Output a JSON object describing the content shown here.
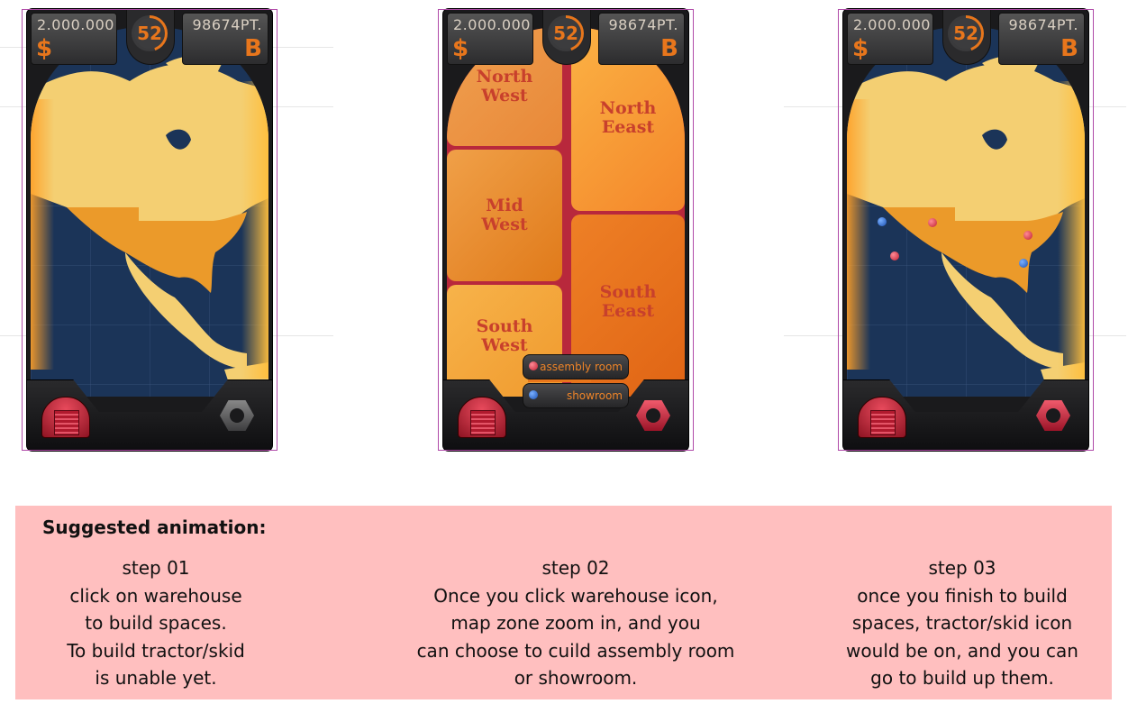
{
  "hud": {
    "money": "2.000.000",
    "money_symbol": "$",
    "level": "52",
    "points": "98674PT.",
    "points_symbol": "B"
  },
  "zones": {
    "north_west": [
      "North",
      "West"
    ],
    "mid_west": [
      "Mid",
      "West"
    ],
    "south_west": [
      "South",
      "West"
    ],
    "north_east": [
      "North",
      "Eeast"
    ],
    "south_east": [
      "South",
      "Eeast"
    ]
  },
  "room_menu": {
    "assembly": "assembly room",
    "showroom": "showroom"
  },
  "icons": {
    "warehouse": "warehouse-icon",
    "tractor": "tractor-skid-icon"
  },
  "colors": {
    "accent": "#e8761c",
    "caption_bg": "#ffbfbf",
    "zone_divider": "#b8283c",
    "active_red": "#c01e30"
  },
  "caption": {
    "title": "Suggested animation:",
    "steps": [
      {
        "heading": "step 01",
        "lines": [
          "click on warehouse",
          "to build spaces.",
          "To build tractor/skid",
          "is unable yet."
        ]
      },
      {
        "heading": "step 02",
        "lines": [
          "Once you click warehouse icon,",
          "map zone zoom in, and you",
          "can choose to cuild assembly room",
          "or showroom."
        ]
      },
      {
        "heading": "step 03",
        "lines": [
          "once you finish to build",
          "spaces, tractor/skid icon",
          "would be on, and you can",
          "go to build up them."
        ]
      }
    ]
  }
}
